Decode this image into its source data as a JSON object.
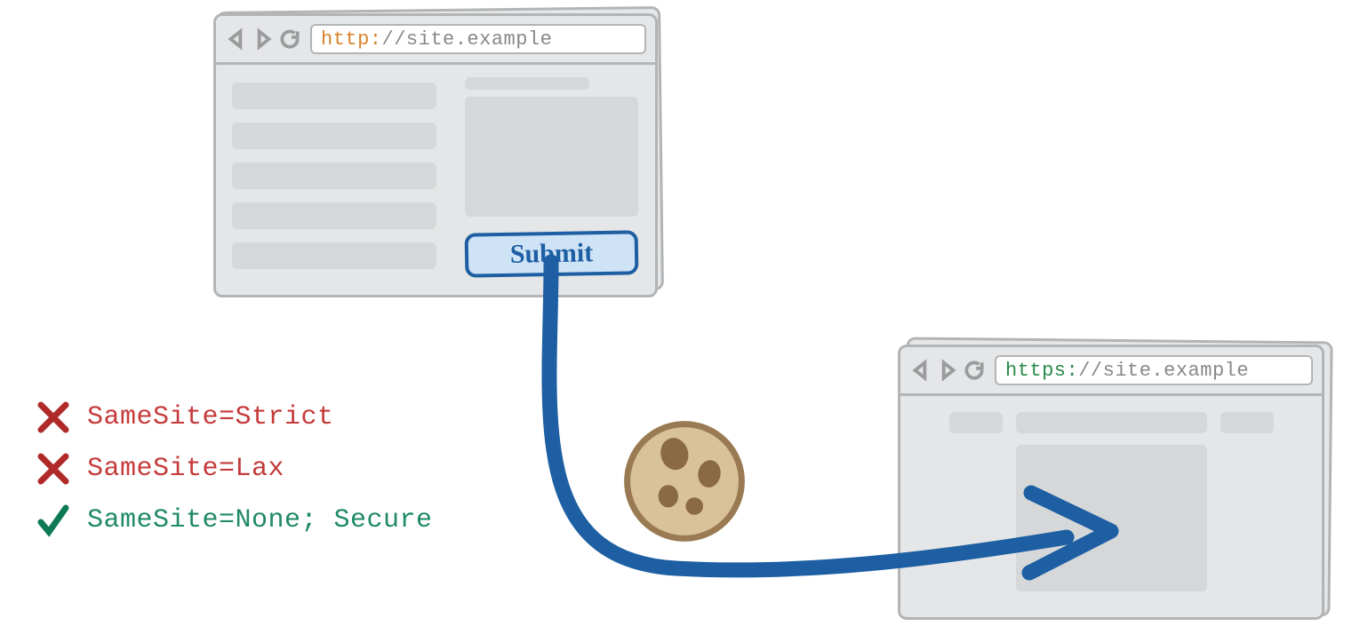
{
  "browserA": {
    "url_scheme": "http:",
    "url_rest": "//site.example",
    "submit_label": "Submit"
  },
  "browserB": {
    "url_scheme": "https:",
    "url_rest": "//site.example"
  },
  "legend": {
    "strict": "SameSite=Strict",
    "lax": "SameSite=Lax",
    "none": "SameSite=None; Secure"
  },
  "icons": {
    "back": "back-icon",
    "forward": "forward-icon",
    "reload": "reload-icon",
    "cross": "cross-icon",
    "check": "check-icon",
    "cookie": "cookie-icon",
    "arrow": "request-arrow"
  }
}
